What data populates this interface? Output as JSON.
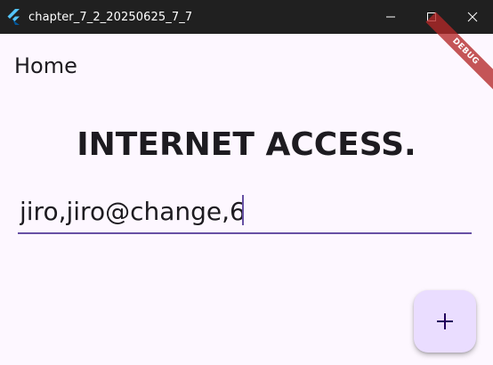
{
  "window": {
    "title": "chapter_7_2_20250625_7_7",
    "controls": [
      "minimize",
      "maximize",
      "close"
    ]
  },
  "appbar": {
    "title": "Home"
  },
  "debug_banner": {
    "label": "DEBUG",
    "color": "#b42828"
  },
  "main": {
    "heading": "INTERNET ACCESS.",
    "input": {
      "value": "jiro,jiro@change,6",
      "placeholder": ""
    }
  },
  "fab": {
    "icon": "plus-icon"
  },
  "colors": {
    "background": "#fdf7ff",
    "accent": "#6750a4",
    "fab_background": "#eaddff",
    "titlebar": "#202020"
  }
}
